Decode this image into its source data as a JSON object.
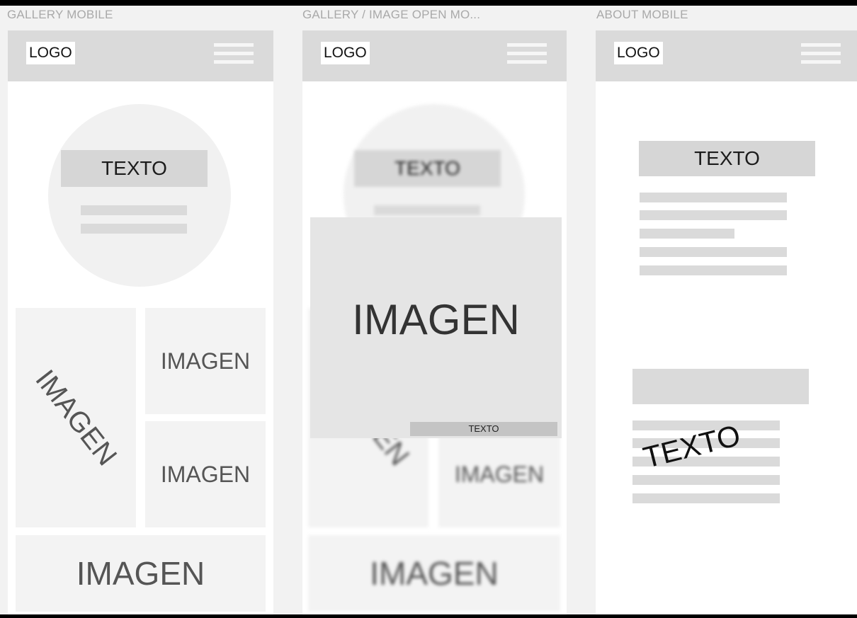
{
  "frames": [
    {
      "label": "GALLERY MOBILE",
      "header": {
        "logo": "LOGO"
      },
      "hero": {
        "title": "TEXTO"
      },
      "tiles": [
        {
          "text": "IMAGEN"
        },
        {
          "text": "IMAGEN"
        },
        {
          "text": "IMAGEN"
        },
        {
          "text": "IMAGEN"
        }
      ]
    },
    {
      "label": "GALLERY / IMAGE OPEN MO...",
      "header": {
        "logo": "LOGO"
      },
      "hero": {
        "title": "TEXTO"
      },
      "tiles": [
        {
          "text": "IMAGEN"
        },
        {
          "text": "IMAGEN"
        },
        {
          "text": "IMAGEN"
        }
      ],
      "modal": {
        "image_text": "IMAGEN",
        "caption": "TEXTO"
      }
    },
    {
      "label": "ABOUT MOBILE",
      "header": {
        "logo": "LOGO"
      },
      "section1": {
        "title": "TEXTO"
      },
      "section2": {
        "overlay_text": "TEXTO"
      }
    }
  ],
  "icons": [
    "hamburger-menu-icon"
  ],
  "colors": {
    "header": "#dadada",
    "placeholder": "#f3f3f3",
    "text_box": "#d6d6d6",
    "background": "#f2f2f2"
  }
}
